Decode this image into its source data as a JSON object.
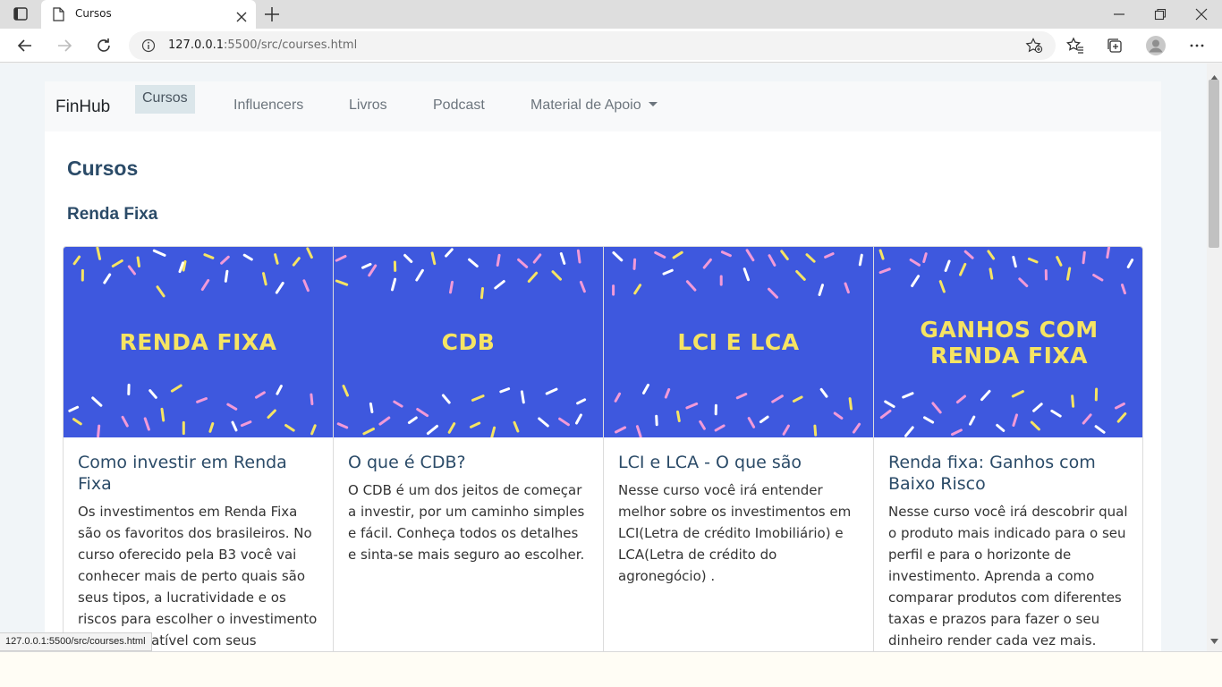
{
  "browser": {
    "tab_title": "Cursos",
    "address_host": "127.0.0.1",
    "address_path": ":5500/src/courses.html",
    "status_url": "127.0.0.1:5500/src/courses.html"
  },
  "navbar": {
    "brand": "FinHub",
    "links": [
      "Cursos",
      "Influencers",
      "Livros",
      "Podcast",
      "Material de Apoio"
    ],
    "active": "Cursos"
  },
  "page": {
    "title": "Cursos",
    "section_title": "Renda Fixa"
  },
  "cards": [
    {
      "image_text": "RENDA FIXA",
      "title": "Como investir em Renda Fixa",
      "text": "Os investimentos em Renda Fixa são os favoritos dos brasileiros. No curso oferecido pela B3 você vai conhecer mais de perto quais são seus tipos, a lucratividade e os riscos para escolher o investimento mais compatível com seus projetos!"
    },
    {
      "image_text": "CDB",
      "title": "O que é CDB?",
      "text": "O CDB é um dos jeitos de começar a investir, por um caminho simples e fácil. Conheça todos os detalhes e sinta-se mais seguro ao escolher."
    },
    {
      "image_text": "LCI E LCA",
      "title": "LCI e LCA - O que são",
      "text": "Nesse curso você irá entender melhor sobre os investimentos em LCI(Letra de crédito Imobiliário) e LCA(Letra de crédito do agronegócio) ."
    },
    {
      "image_text": "GANHOS COM RENDA FIXA",
      "title": "Renda fixa: Ganhos com Baixo Risco",
      "text": "Nesse curso você irá descobrir qual o produto mais indicado para o seu perfil e para o horizonte de investimento. Aprenda a como comparar produtos com diferentes taxas e prazos para fazer o seu dinheiro render cada vez mais."
    }
  ],
  "colors": {
    "card_image_bg": "#3e58de",
    "card_image_text": "#f6e463",
    "heading": "#2b4b68",
    "nav_active_bg": "#dbe6ea"
  },
  "icons": [
    "tab-actions-icon",
    "page-icon",
    "close-icon",
    "plus-icon",
    "minimize-icon",
    "restore-icon",
    "back-icon",
    "forward-icon",
    "refresh-icon",
    "info-icon",
    "add-favorite-icon",
    "favorites-icon",
    "collections-icon",
    "profile-icon",
    "more-icon"
  ]
}
